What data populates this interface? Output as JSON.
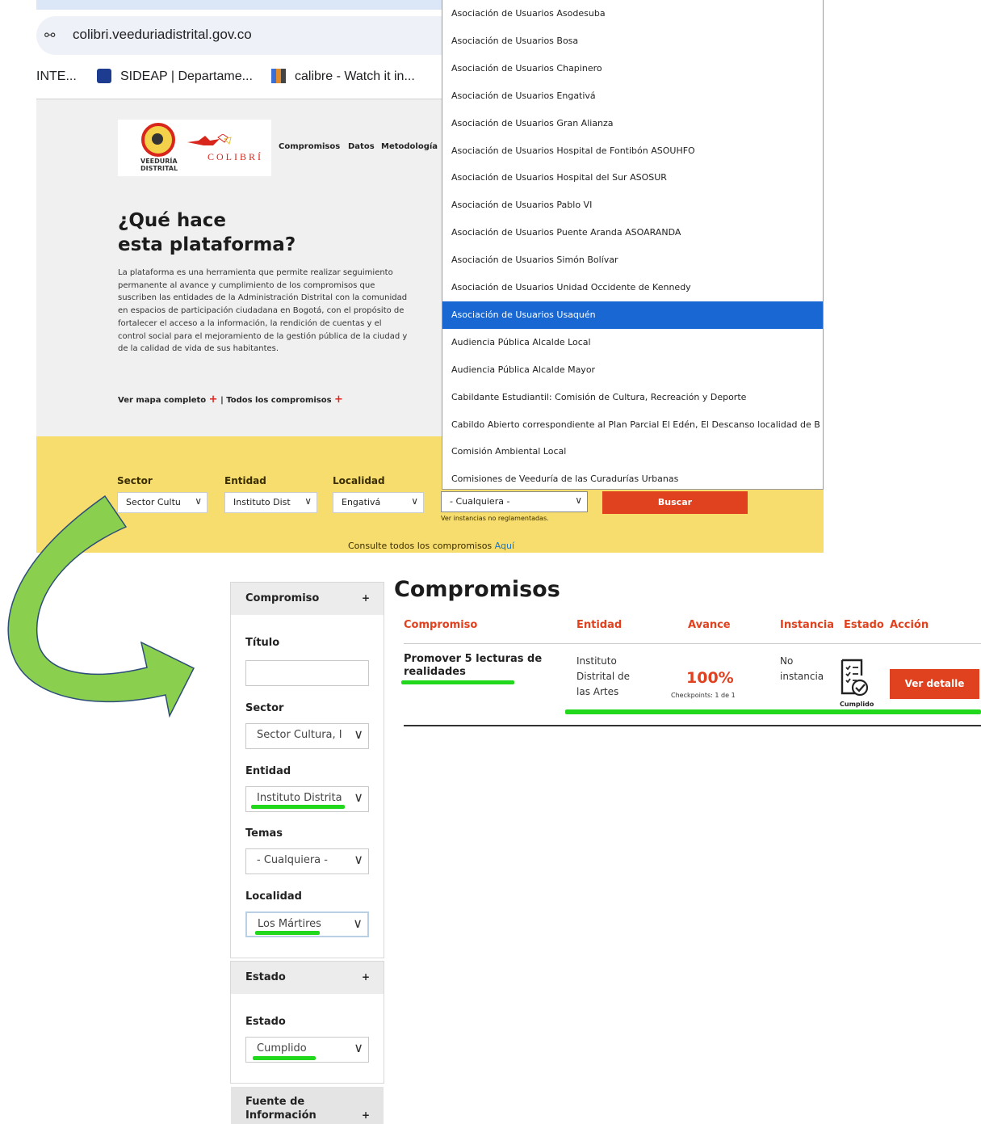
{
  "browser": {
    "url": "colibri.veeduriadistrital.gov.co",
    "bookmarks": [
      "INTE...",
      "SIDEAP | Departame...",
      "calibre - Watch it in..."
    ]
  },
  "site": {
    "logo_text": "COLIBRÍ",
    "logo_subtext": "VEEDURÍA DISTRITAL",
    "nav": [
      "Compromisos",
      "Datos",
      "Metodología"
    ],
    "hero_title_line1": "¿Qué hace",
    "hero_title_line2": "esta plataforma?",
    "hero_description": "La plataforma es una herramienta que permite realizar seguimiento permanente al avance y cumplimiento de los compromisos que suscriben las entidades de la Administración Distrital con la comunidad en espacios de participación ciudadana en Bogotá, con el propósito de fortalecer el acceso a la información, la rendición de cuentas y el control social para el mejoramiento de la gestión pública de la ciudad y de la calidad de vida de sus habitantes.",
    "link_mapa": "Ver mapa completo",
    "link_separator": "|",
    "link_todos": "Todos los compromisos"
  },
  "filters": {
    "sector_label": "Sector",
    "sector_value": "Sector Cultu",
    "entidad_label": "Entidad",
    "entidad_value": "Instituto Dist",
    "localidad_label": "Localidad",
    "localidad_value": "Engativá",
    "instancia_value": "- Cualquiera -",
    "buscar_label": "Buscar",
    "instancias_note": "Ver instancias no reglamentadas.",
    "consulte_text": "Consulte todos los compromisos",
    "consulte_link": "Aquí"
  },
  "dropdown": {
    "selected_index": 11,
    "options": [
      "Asociación de Usuarios Asodesuba",
      "Asociación de Usuarios Bosa",
      "Asociación de Usuarios Chapinero",
      "Asociación de Usuarios Engativá",
      "Asociación de Usuarios Gran Alianza",
      "Asociación de Usuarios Hospital de Fontibón ASOUHFO",
      "Asociación de Usuarios Hospital del Sur ASOSUR",
      "Asociación de Usuarios Pablo VI",
      "Asociación de Usuarios Puente Aranda ASOARANDA",
      "Asociación de Usuarios Simón Bolívar",
      "Asociación de Usuarios Unidad Occidente de Kennedy",
      "Asociación de Usuarios Usaquén",
      "Audiencia Pública Alcalde Local",
      "Audiencia Pública Alcalde Mayor",
      "Cabildante Estudiantil: Comisión de Cultura, Recreación y Deporte",
      "Cabildo Abierto correspondiente al Plan Parcial El Edén, El Descanso localidad de B",
      "Comisión Ambiental Local",
      "Comisiones de Veeduría de las Curadurías Urbanas"
    ]
  },
  "sidebar": {
    "compromiso_header": "Compromiso",
    "titulo_label": "Título",
    "titulo_value": "",
    "sector_label": "Sector",
    "sector_value": "Sector Cultura, I",
    "entidad_label": "Entidad",
    "entidad_value": "Instituto Distrita",
    "temas_label": "Temas",
    "temas_value": "- Cualquiera -",
    "localidad_label": "Localidad",
    "localidad_value": "Los Mártires",
    "estado_header": "Estado",
    "estado_label": "Estado",
    "estado_value": "Cumplido",
    "fuente_header_line1": "Fuente de",
    "fuente_header_line2": "Información",
    "plus": "+"
  },
  "results": {
    "title": "Compromisos",
    "columns": [
      "Compromiso",
      "Entidad",
      "Avance",
      "Instancia",
      "Estado",
      "Acción"
    ],
    "rows": [
      {
        "compromiso": "Promover 5 lecturas de realidades",
        "entidad": "Instituto Distrital de las Artes",
        "avance": "100%",
        "checkpoints": "Checkpoints: 1 de 1",
        "instancia": "No instancia",
        "estado": "Cumplido",
        "accion": "Ver detalle"
      }
    ]
  },
  "colors": {
    "accent_red": "#e0411e",
    "filter_yellow": "#f6dd6d",
    "highlight_green": "#22d81c",
    "arrow_green": "#8bcf4f",
    "selected_blue": "#1967d2"
  }
}
